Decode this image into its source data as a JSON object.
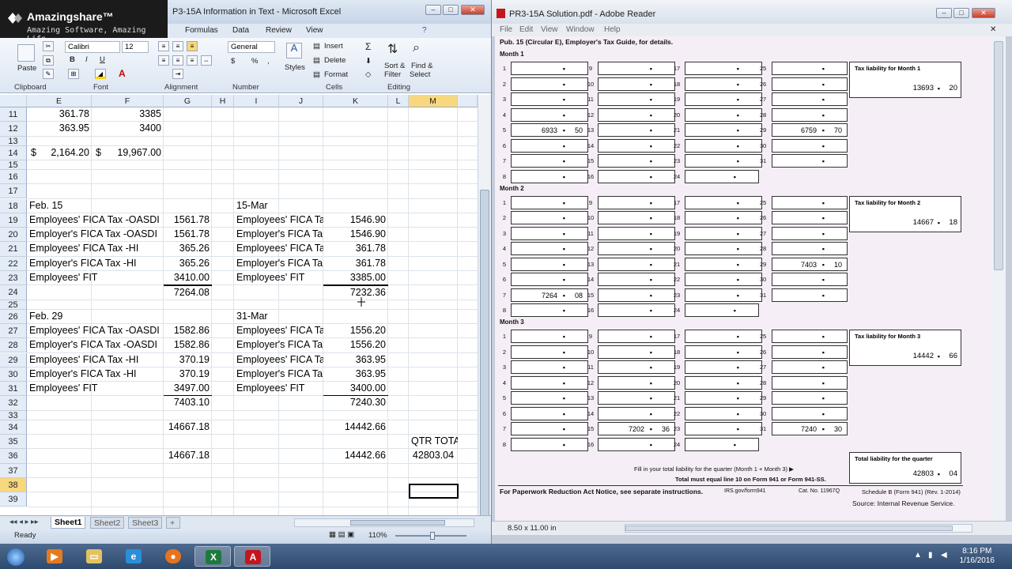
{
  "excel": {
    "window_title": "P3-15A Information in Text - Microsoft Excel",
    "logo": {
      "brand": "Amazingshare™",
      "tagline": "Amazing Software, Amazing Life"
    },
    "ribbon_tabs": [
      "Formulas",
      "Data",
      "Review",
      "View"
    ],
    "ribbon": {
      "paste": "Paste",
      "font_name": "Calibri",
      "font_size": "12",
      "bold": "B",
      "italic": "I",
      "underline": "U",
      "number_format": "General",
      "styles": "Styles",
      "insert": "Insert",
      "delete": "Delete",
      "format": "Format",
      "sort_filter_1": "Sort &",
      "sort_filter_2": "Filter",
      "find_select_1": "Find &",
      "find_select_2": "Select",
      "groups": {
        "clipboard": "Clipboard",
        "font": "Font",
        "alignment": "Alignment",
        "number": "Number",
        "cells": "Cells",
        "editing": "Editing"
      }
    },
    "columns": [
      "E",
      "F",
      "G",
      "H",
      "I",
      "J",
      "K",
      "L",
      "M"
    ],
    "rows": [
      "11",
      "12",
      "13",
      "14",
      "15",
      "16",
      "17",
      "18",
      "19",
      "20",
      "21",
      "22",
      "23",
      "24",
      "25",
      "26",
      "27",
      "28",
      "29",
      "30",
      "31",
      "32",
      "33",
      "34",
      "35",
      "36",
      "37",
      "38",
      "39"
    ],
    "cells": {
      "e11": "361.78",
      "f11": "3385",
      "e12": "363.95",
      "f12": "3400",
      "e14a": "$",
      "e14": "2,164.20",
      "f14a": "$",
      "f14": "19,967.00",
      "e18": "Feb. 15",
      "i18": "15-Mar",
      "e19": "Employees' FICA Tax -OASDI",
      "g19": "1561.78",
      "i19": "Employees' FICA Ta",
      "k19": "1546.90",
      "e20": "Employer's FICA Tax -OASDI",
      "g20": "1561.78",
      "i20": "Employer's FICA Ta",
      "k20": "1546.90",
      "e21": "Employees' FICA Tax -HI",
      "g21": "365.26",
      "i21": "Employees' FICA Ta",
      "k21": "361.78",
      "e22": "Employer's FICA Tax -HI",
      "g22": "365.26",
      "i22": "Employer's FICA Ta",
      "k22": "361.78",
      "e23": "Employees' FIT",
      "g23": "3410.00",
      "i23": "Employees' FIT",
      "k23": "3385.00",
      "g24": "7264.08",
      "k24": "7232.36",
      "e26": "Feb. 29",
      "i26": "31-Mar",
      "e27": "Employees' FICA Tax -OASDI",
      "g27": "1582.86",
      "i27": "Employees' FICA Ta",
      "k27": "1556.20",
      "e28": "Employer's FICA Tax -OASDI",
      "g28": "1582.86",
      "i28": "Employer's FICA Ta",
      "k28": "1556.20",
      "e29": "Employees' FICA Tax -HI",
      "g29": "370.19",
      "i29": "Employees' FICA Ta",
      "k29": "363.95",
      "e30": "Employer's FICA Tax -HI",
      "g30": "370.19",
      "i30": "Employer's FICA Ta",
      "k30": "363.95",
      "e31": "Employees' FIT",
      "g31": "3497.00",
      "i31": "Employees' FIT",
      "k31": "3400.00",
      "g32": "7403.10",
      "k32": "7240.30",
      "g34": "14667.18",
      "k34": "14442.66",
      "m35": "QTR TOTAL",
      "g36": "14667.18",
      "k36": "14442.66",
      "m36": "42803.04"
    },
    "sheet_tabs": [
      "Sheet1",
      "Sheet2",
      "Sheet3"
    ],
    "status": {
      "ready": "Ready",
      "zoom": "110%"
    }
  },
  "adobe": {
    "window_title": "PR3-15A Solution.pdf - Adobe Reader",
    "menu": [
      "File",
      "Edit",
      "View",
      "Window",
      "Help"
    ],
    "header_text": "Pub. 15 (Circular E), Employer's Tax Guide, for details.",
    "months": [
      {
        "label": "Month 1",
        "liability_label": "Tax liability for Month 1",
        "total": "13693",
        "total_cents": "20",
        "entries": [
          {
            "day": "5",
            "dollars": "6933",
            "cents": "50"
          },
          {
            "day": "29",
            "dollars": "6759",
            "cents": "70"
          }
        ]
      },
      {
        "label": "Month 2",
        "liability_label": "Tax liability for Month 2",
        "total": "14667",
        "total_cents": "18",
        "entries": [
          {
            "day": "7",
            "dollars": "7264",
            "cents": "08"
          },
          {
            "day": "29",
            "dollars": "7403",
            "cents": "10"
          }
        ]
      },
      {
        "label": "Month 3",
        "liability_label": "Tax liability for Month 3",
        "total": "14442",
        "total_cents": "66",
        "entries": [
          {
            "day": "15",
            "dollars": "7202",
            "cents": "36"
          },
          {
            "day": "31",
            "dollars": "7240",
            "cents": "30"
          }
        ]
      }
    ],
    "quarter": {
      "label": "Total liability for the quarter",
      "total": "42803",
      "cents": "04",
      "note1": "Fill in your total liability for the quarter (Month 1 + Month 3) ▶",
      "note2": "Total must equal line 10 on Form 941 or Form 941-SS."
    },
    "footer": {
      "left": "For Paperwork Reduction Act Notice, see separate instructions.",
      "mid": "IRS.gov/form941",
      "cat": "Cat. No. 11967Q",
      "right": "Schedule B (Form 941) (Rev. 1-2014)",
      "source": "Source: Internal Revenue Service."
    },
    "page_size": "8.50 x 11.00 in"
  },
  "taskbar": {
    "time": "8:16 PM",
    "date": "1/16/2016"
  }
}
